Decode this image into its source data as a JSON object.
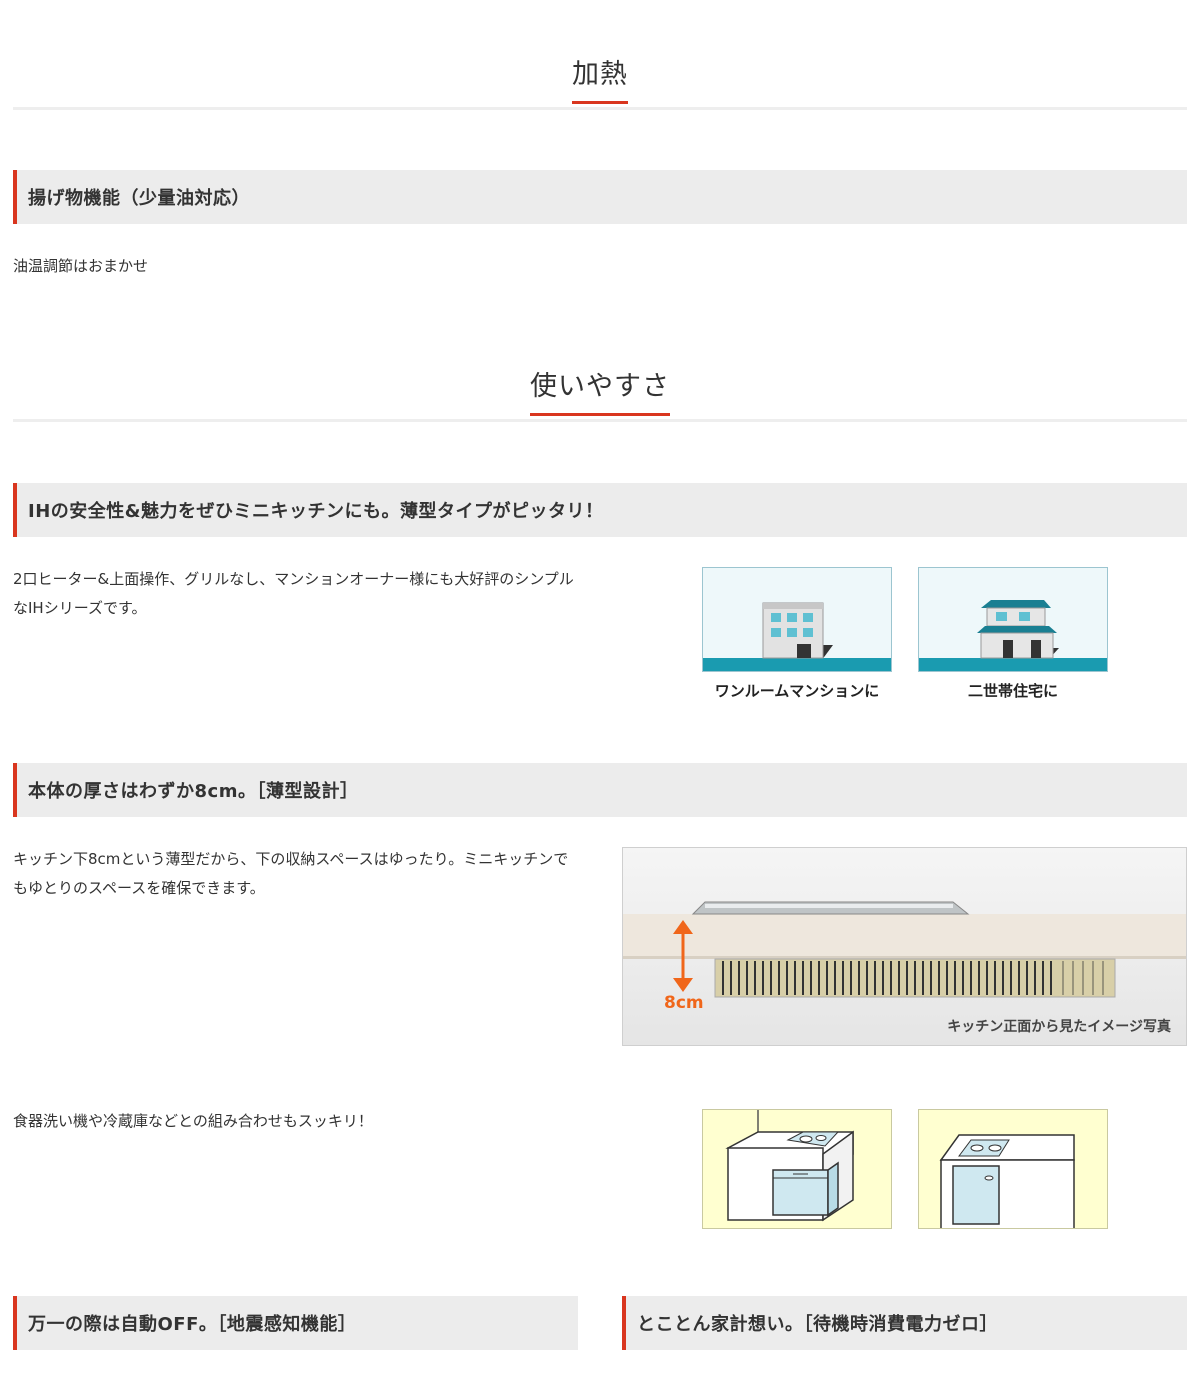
{
  "sections": [
    {
      "title": "加熱"
    },
    {
      "title": "使いやすさ"
    }
  ],
  "features": {
    "fry": {
      "title": "揚げ物機能（少量油対応）",
      "text": "油温調節はおまかせ"
    },
    "mini": {
      "title": "IHの安全性&魅力をぜひミニキッチンにも。薄型タイプがピッタリ！",
      "text": "2口ヒーター&上面操作、グリルなし、マンションオーナー様にも大好評のシンプルなIHシリーズです。",
      "figures": [
        {
          "caption": "ワンルームマンションに"
        },
        {
          "caption": "二世帯住宅に"
        }
      ]
    },
    "thin": {
      "title": "本体の厚さはわずか8cm。［薄型設計］",
      "text": "キッチン下8cmという薄型だから、下の収納スペースはゆったり。ミニキッチンでもゆとりのスペースを確保できます。",
      "photo_label": "8cm",
      "photo_caption": "キッチン正面から見たイメージ写真",
      "text2": "食器洗い機や冷蔵庫などとの組み合わせもスッキリ！"
    },
    "quake": {
      "title": "万一の際は自動OFF。［地震感知機能］"
    },
    "standby": {
      "title": "とことん家計想い。［待機時消費電力ゼロ］"
    }
  },
  "colors": {
    "accent": "#d9361f",
    "bar_bg": "#ececec",
    "teal": "#1a9bb0",
    "arrow": "#f0661a"
  }
}
